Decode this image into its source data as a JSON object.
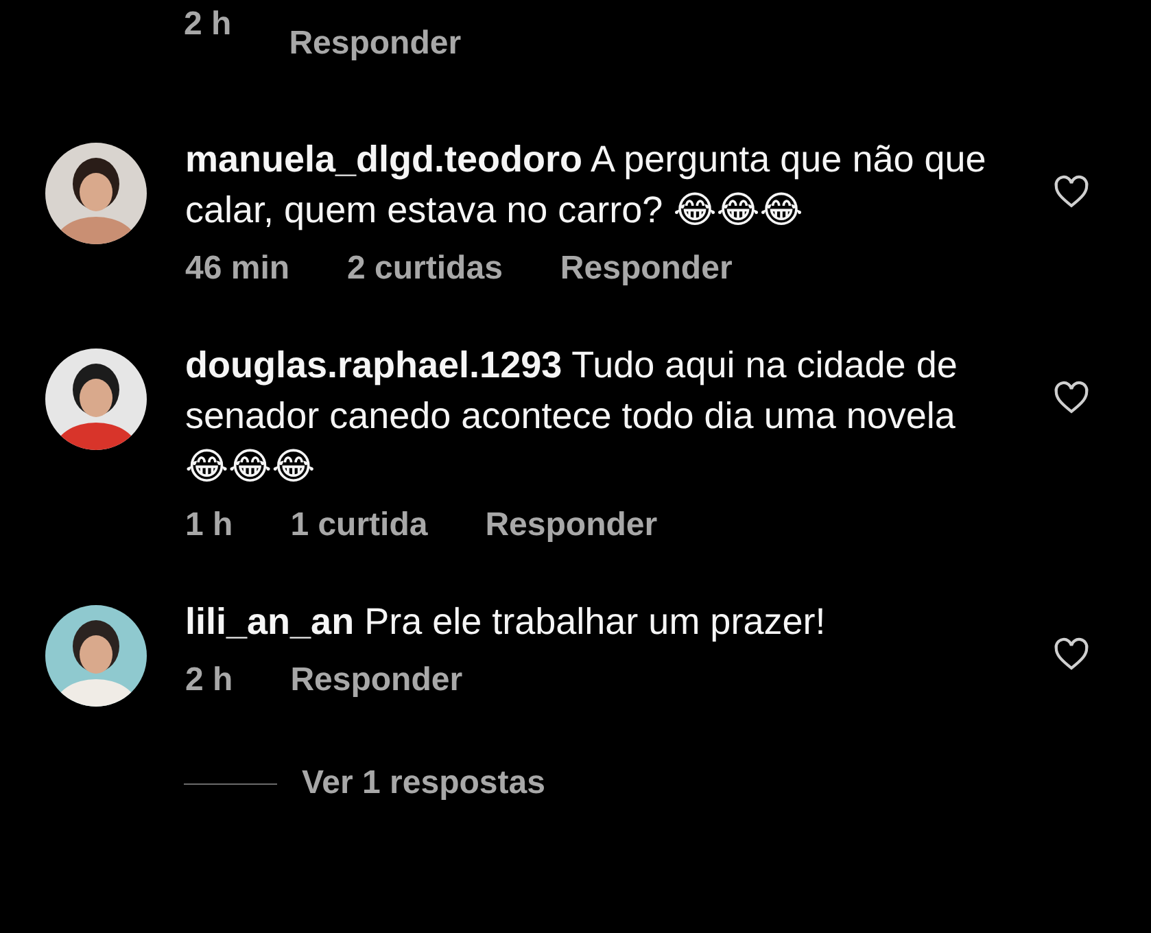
{
  "top_meta": {
    "time": "2 h",
    "reply": "Responder"
  },
  "comments": [
    {
      "username": "manuela_dlgd.teodoro",
      "text": "A pergunta que não que calar, quem estava no carro? 😂😂😂",
      "time": "46 min",
      "likes": "2 curtidas",
      "reply": "Responder",
      "liked": false
    },
    {
      "username": "douglas.raphael.1293",
      "text": "Tudo aqui na cidade de senador canedo acontece  todo dia uma novela 😂😂😂",
      "time": "1 h",
      "likes": "1 curtida",
      "reply": "Responder",
      "liked": false
    },
    {
      "username": "lili_an_an",
      "text": "Pra ele trabalhar um prazer!",
      "time": "2 h",
      "reply": "Responder",
      "liked": false
    }
  ],
  "view_replies": "Ver 1 respostas"
}
